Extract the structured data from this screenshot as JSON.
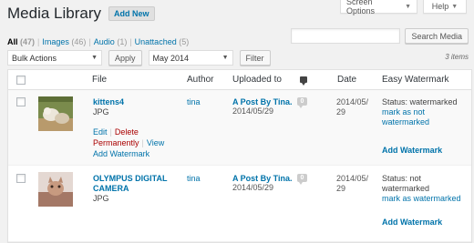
{
  "screen_meta": {
    "options_label": "Screen Options",
    "help_label": "Help"
  },
  "header": {
    "title": "Media Library",
    "add_new_label": "Add New"
  },
  "filters": {
    "all": {
      "label": "All",
      "count": "(47)"
    },
    "images": {
      "label": "Images",
      "count": "(46)"
    },
    "audio": {
      "label": "Audio",
      "count": "(1)"
    },
    "unattached": {
      "label": "Unattached",
      "count": "(5)"
    }
  },
  "search": {
    "value": "",
    "placeholder": "",
    "button_label": "Search Media"
  },
  "tablenav": {
    "bulk_selected": "Bulk Actions",
    "apply_label": "Apply",
    "month_selected": "May 2014",
    "filter_label": "Filter",
    "items_count": "3 items"
  },
  "columns": {
    "file": "File",
    "author": "Author",
    "uploaded_to": "Uploaded to",
    "date": "Date",
    "watermark": "Easy Watermark"
  },
  "rows": [
    {
      "title": "kittens4",
      "ext": "JPG",
      "actions": {
        "edit": "Edit",
        "delete_1": "Delete",
        "delete_2": "Permanently",
        "view": "View",
        "add_wm": "Add Watermark"
      },
      "author": "tina",
      "uploaded_to": "A Post By Tina.",
      "uploaded_date": "2014/05/29",
      "comments": "0",
      "date_1": "2014/05/",
      "date_2": "29",
      "wm_status": "Status: watermarked",
      "wm_mark_1": "mark as not",
      "wm_mark_2": "watermarked",
      "wm_add": "Add Watermark"
    },
    {
      "title_1": "OLYMPUS DIGITAL",
      "title_2": "CAMERA",
      "ext": "JPG",
      "author": "tina",
      "uploaded_to": "A Post By Tina.",
      "uploaded_date": "2014/05/29",
      "comments": "0",
      "date_1": "2014/05/",
      "date_2": "29",
      "wm_status_1": "Status: not",
      "wm_status_2": "watermarked",
      "wm_mark": "mark as watermarked",
      "wm_add": "Add Watermark"
    }
  ],
  "colors": {
    "link": "#0073aa",
    "delete": "#aa0000",
    "background": "#f1f1f1"
  }
}
